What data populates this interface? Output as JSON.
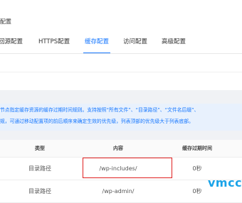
{
  "page": {
    "title": "配置"
  },
  "tabs": [
    {
      "label": "回源配置",
      "active": false
    },
    {
      "label": "HTTPS配置",
      "active": false
    },
    {
      "label": "缓存配置",
      "active": true
    },
    {
      "label": "访问配置",
      "active": false
    },
    {
      "label": "高级配置",
      "active": false
    }
  ],
  "info": {
    "line1": "节点指定缓存资源的缓存过期时间规则。支持按照“所有文件”、“目录路径”、“文件名后缀”、",
    "line2": "规，可通过移动配置项的前后顺序来确定生效的优先级，列表顶部的优先级大于列表底部。"
  },
  "table": {
    "headers": {
      "type": "类型",
      "content": "内容",
      "ttl": "缓存过期时间"
    },
    "rows": [
      {
        "type": "目录路径",
        "content": "/wp-includes/",
        "ttl": "0秒"
      },
      {
        "type": "目录路径",
        "content": "/wp-admin/",
        "ttl": "0秒"
      }
    ]
  },
  "watermark": "vmcc",
  "colors": {
    "accent": "#1677ff",
    "highlight": "#e02020",
    "watermark": "#1aa3e8",
    "info_bg": "#e8f1fd"
  }
}
